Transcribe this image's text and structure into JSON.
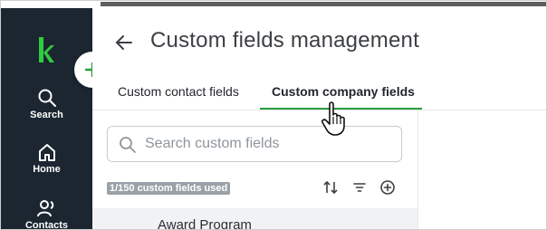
{
  "page": {
    "title": "Custom fields management"
  },
  "sidebar": {
    "items": [
      {
        "label": "Search",
        "icon": "search-icon"
      },
      {
        "label": "Home",
        "icon": "home-icon"
      },
      {
        "label": "Contacts",
        "icon": "contacts-icon"
      }
    ],
    "brand_color": "#2ecc40"
  },
  "tabs": [
    {
      "label": "Custom contact fields",
      "active": false
    },
    {
      "label": "Custom company fields",
      "active": true
    }
  ],
  "search": {
    "placeholder": "Search custom fields"
  },
  "usage": {
    "label": "1/150 custom fields used"
  },
  "list": {
    "first_row_partial": "Award Program"
  },
  "colors": {
    "sidebar_bg": "#1b2631",
    "accent_green": "#2a9d3c",
    "text_dark": "#3c3f44"
  }
}
